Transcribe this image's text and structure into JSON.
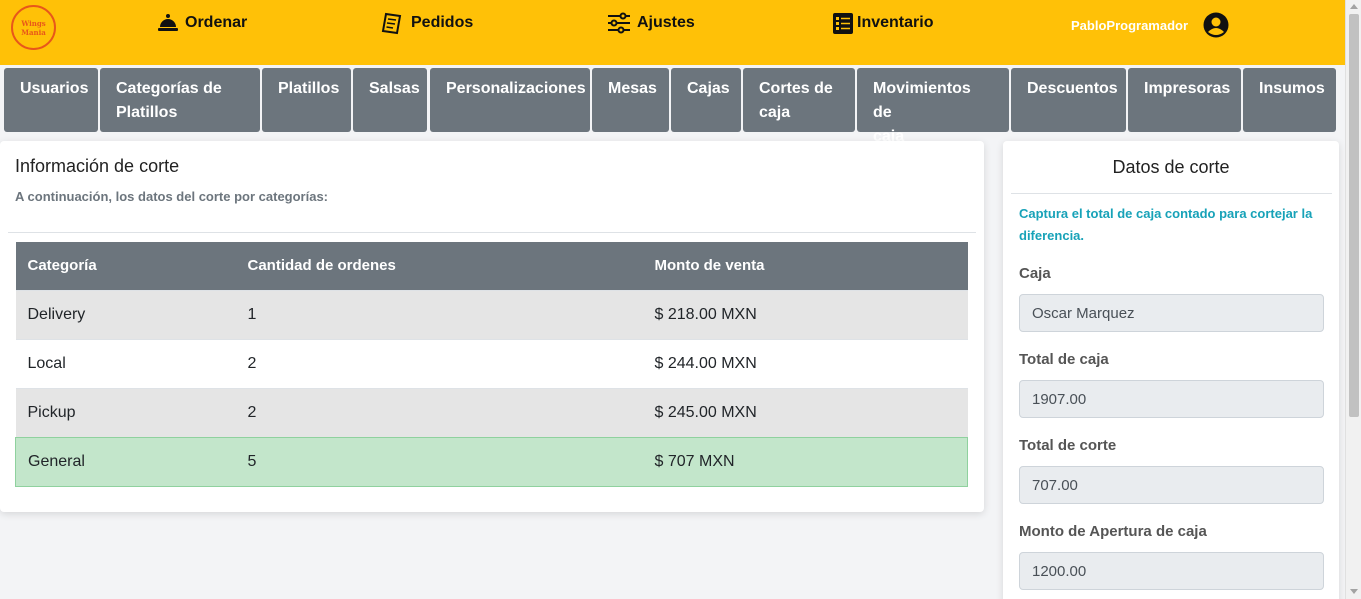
{
  "logo": {
    "text_line1": "Wings",
    "text_line2": "Mania"
  },
  "nav": {
    "order": "Ordenar",
    "orders": "Pedidos",
    "settings": "Ajustes",
    "inventory": "Inventario",
    "user": "PabloProgramador"
  },
  "tabs": [
    {
      "line1": "Usuarios",
      "line2": ""
    },
    {
      "line1": "Categorías de",
      "line2": "Platillos"
    },
    {
      "line1": "Platillos",
      "line2": ""
    },
    {
      "line1": "Salsas",
      "line2": ""
    },
    {
      "line1": "Personalizaciones",
      "line2": ""
    },
    {
      "line1": "Mesas",
      "line2": ""
    },
    {
      "line1": "Cajas",
      "line2": ""
    },
    {
      "line1": "Cortes de",
      "line2": "caja"
    },
    {
      "line1": "Movimientos de",
      "line2": "caja"
    },
    {
      "line1": "Descuentos",
      "line2": ""
    },
    {
      "line1": "Impresoras",
      "line2": ""
    },
    {
      "line1": "Insumos",
      "line2": ""
    }
  ],
  "cut_info": {
    "title": "Información de corte",
    "subtitle": "A continuación, los datos del corte por categorías:",
    "headers": [
      "Categoría",
      "Cantidad de ordenes",
      "Monto de venta"
    ],
    "rows": [
      {
        "category": "Delivery",
        "count": "1",
        "amount": "$ 218.00 MXN"
      },
      {
        "category": "Local",
        "count": "2",
        "amount": "$ 244.00 MXN"
      },
      {
        "category": "Pickup",
        "count": "2",
        "amount": "$ 245.00 MXN"
      },
      {
        "category": "General",
        "count": "5",
        "amount": "$ 707 MXN"
      }
    ]
  },
  "cut_data": {
    "title": "Datos de corte",
    "info": "Captura el total de caja contado para cortejar la diferencia.",
    "fields": [
      {
        "label": "Caja",
        "value": "Oscar Marquez"
      },
      {
        "label": "Total de caja",
        "value": "1907.00"
      },
      {
        "label": "Total de corte",
        "value": "707.00"
      },
      {
        "label": "Monto de Apertura de caja",
        "value": "1200.00"
      }
    ]
  },
  "colors": {
    "navbar": "#ffc107",
    "tab": "#6c757d",
    "total_row": "#c3e6cb",
    "info_text": "#17a2b8"
  }
}
